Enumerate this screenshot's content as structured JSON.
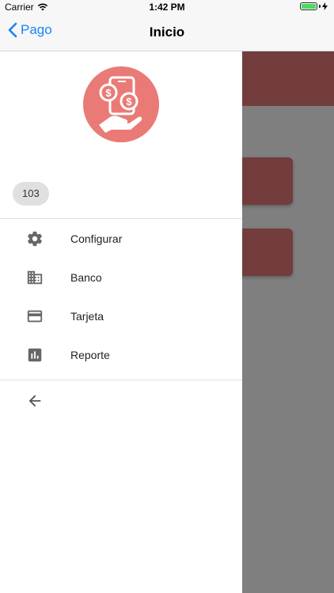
{
  "status_bar": {
    "carrier": "Carrier",
    "time": "1:42 PM"
  },
  "nav": {
    "back_label": "Pago",
    "title": "Inicio"
  },
  "drawer": {
    "badge": "103",
    "menu_items": [
      {
        "label": "Configurar",
        "icon": "gear-icon"
      },
      {
        "label": "Banco",
        "icon": "bank-icon"
      },
      {
        "label": "Tarjeta",
        "icon": "credit-card-icon"
      },
      {
        "label": "Reporte",
        "icon": "report-icon"
      }
    ],
    "back_icon": "arrow-left-icon"
  },
  "colors": {
    "accent": "#1a82fb",
    "avatar": "#e97a76",
    "overlay_content": "#733d3d",
    "overlay": "#7f7f7f",
    "battery": "#4cd964"
  }
}
